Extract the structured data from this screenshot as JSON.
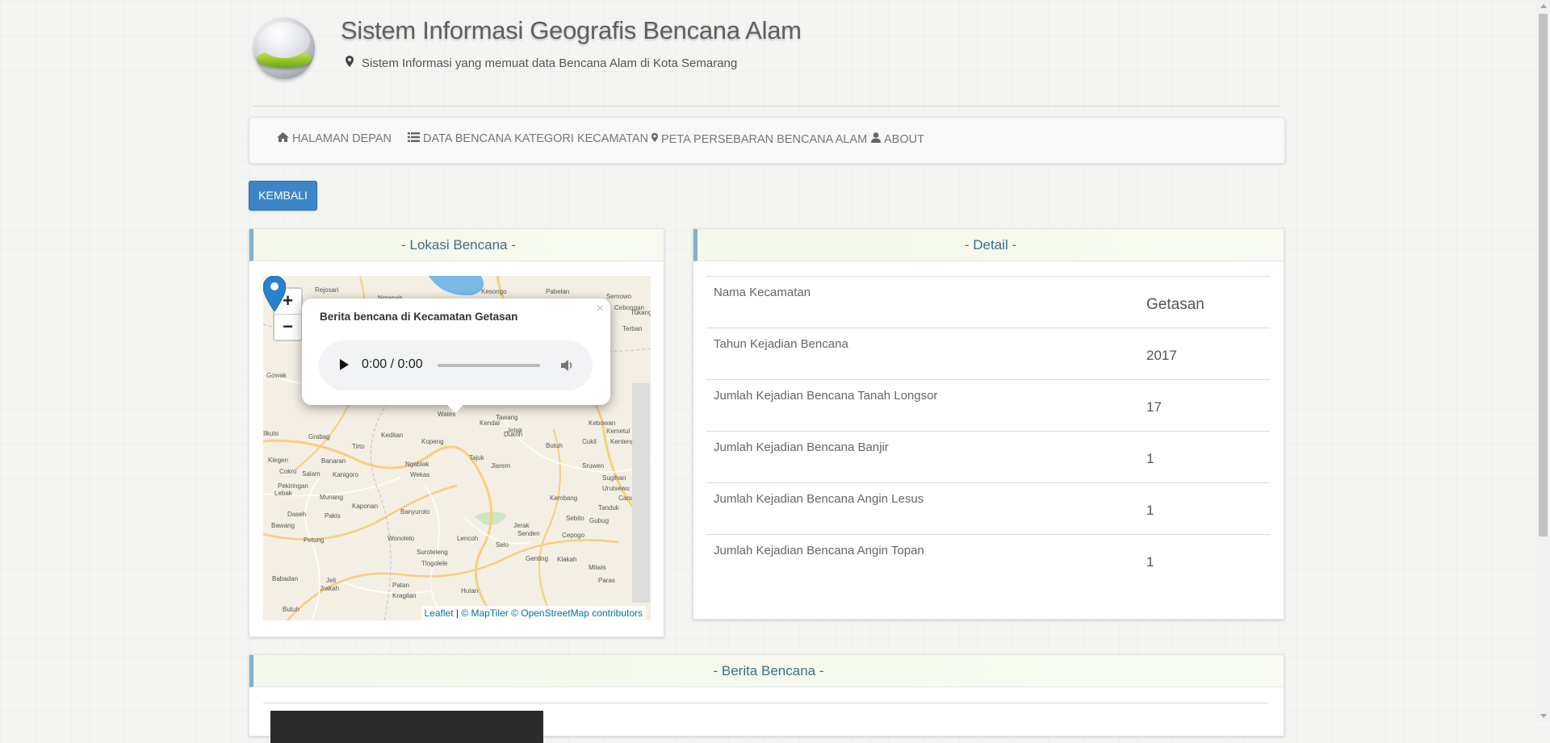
{
  "header": {
    "title": "Sistem Informasi Geografis Bencana Alam",
    "subtitle": "Sistem Informasi yang memuat data Bencana Alam di Kota Semarang"
  },
  "nav": {
    "items": [
      {
        "icon": "home-icon",
        "label": "HALAMAN DEPAN"
      },
      {
        "icon": "list-icon",
        "label": "DATA BENCANA KATEGORI KECAMATAN"
      },
      {
        "icon": "map-marker-icon",
        "label": "PETA PERSEBARAN BENCANA ALAM"
      },
      {
        "icon": "user-icon",
        "label": "ABOUT"
      }
    ]
  },
  "back_button": "KEMBALI",
  "lokasi": {
    "title": "- Lokasi Bencana -",
    "zoom_in": "+",
    "zoom_out": "−",
    "popup": {
      "title": "Berita bencana di Kecamatan Getasan",
      "close": "×",
      "audio_time": "0:00 / 0:00"
    },
    "attribution": {
      "leaflet": "Leaflet",
      "sep": " | ",
      "tiles": "© MapTiler © OpenStreetMap contributors"
    },
    "place_labels": [
      "Rejosari",
      "Ngrapah",
      "Kesongo",
      "Pabelan",
      "Semowo",
      "Cebongan",
      "Tukang",
      "Terban",
      "Gowak",
      "Wates",
      "Tawang",
      "Kendal",
      "Jetak",
      "Kebowan",
      "Kemetul",
      "Kenteng",
      "Ilkuto",
      "Grabag",
      "Keditan",
      "Kopeng",
      "Dukoh",
      "Butuh",
      "Cukil",
      "Klegen",
      "Banaran",
      "Tirto",
      "Ngablak",
      "Tajuk",
      "Jlarem",
      "Sruwen",
      "Sugihan",
      "Urutsewu",
      "Candi",
      "Kembang",
      "Tanduk",
      "Sebito",
      "Gubug",
      "Cokro",
      "Salam",
      "Kanigoro",
      "Wekas",
      "Pekiringan",
      "Lebak",
      "Munang",
      "Kaponan",
      "Daseh",
      "Pakis",
      "Banyuroto",
      "Jerak",
      "Senden",
      "Cepogo",
      "Bawang",
      "Petung",
      "Wonolelo",
      "Lencoh",
      "Selo",
      "Genting",
      "Klakah",
      "Suroteleng",
      "Mliwis",
      "Tlogolele",
      "Paras",
      "Babadan",
      "Jrakah",
      "Jeli",
      "Patan",
      "Kragilan",
      "Hutan",
      "Butuh"
    ]
  },
  "detail": {
    "title": "- Detail -",
    "rows": [
      {
        "label": "Nama Kecamatan",
        "value": "Getasan"
      },
      {
        "label": "Tahun Kejadian Bencana",
        "value": "2017"
      },
      {
        "label": "Jumlah Kejadian Bencana Tanah Longsor",
        "value": "17"
      },
      {
        "label": "Jumlah Kejadian Bencana Banjir",
        "value": "1"
      },
      {
        "label": "Jumlah Kejadian Bencana Angin Lesus",
        "value": "1"
      },
      {
        "label": "Jumlah Kejadian Bencana Angin Topan",
        "value": "1"
      }
    ]
  },
  "berita": {
    "title": "- Berita Bencana -"
  },
  "colors": {
    "accent": "#3c86c7",
    "panel_head_bg": "#f3f8ea",
    "panel_head_border": "#80b3c4",
    "panel_head_text": "#3e6f84",
    "marker": "#2a81cb"
  }
}
